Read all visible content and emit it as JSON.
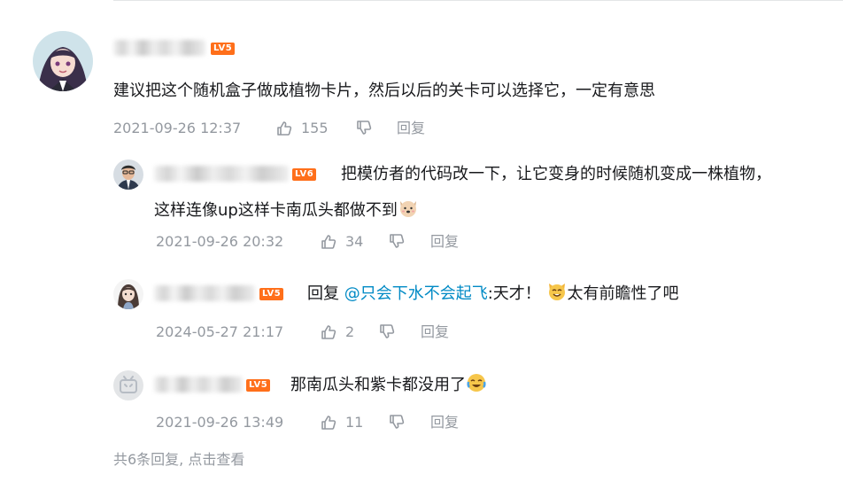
{
  "main_comment": {
    "level": "LV5",
    "text": "建议把这个随机盒子做成植物卡片，然后以后的关卡可以选择它，一定有意思",
    "time": "2021-09-26 12:37",
    "likes": "155",
    "reply_label": "回复"
  },
  "replies": [
    {
      "level": "LV6",
      "text_line1": "把模仿者的代码改一下，让它变身的时候随机变成一株植物，",
      "text_line2": "这样连像up这样卡南瓜头都做不到",
      "emoji": "dog-face-emoji",
      "time": "2021-09-26 20:32",
      "likes": "34",
      "reply_label": "回复"
    },
    {
      "level": "LV5",
      "reply_prefix": "回复",
      "mention": "@只会下水不会起飞",
      "text_a": ":天才！",
      "text_b": "太有前瞻性了吧",
      "emoji": "cat-face-emoji",
      "time": "2024-05-27 21:17",
      "likes": "2",
      "reply_label": "回复"
    },
    {
      "level": "LV5",
      "text": "那南瓜头和紫卡都没用了",
      "emoji": "crying-laugh-emoji",
      "time": "2021-09-26 13:49",
      "likes": "11",
      "reply_label": "回复"
    }
  ],
  "footer": {
    "text": "共6条回复, 点击查看"
  },
  "colors": {
    "text": "#18191c",
    "meta": "#9499a0",
    "mention": "#008ac5",
    "level_badge": "#ff6f1a"
  }
}
